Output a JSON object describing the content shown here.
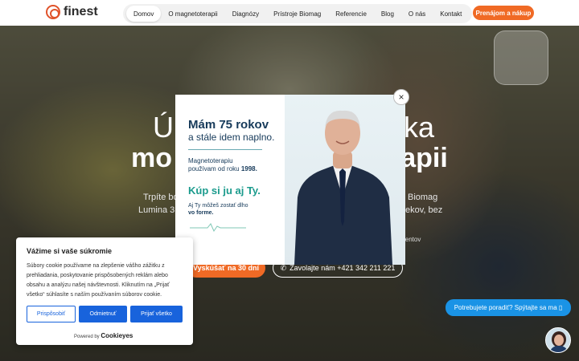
{
  "nav": {
    "logo": "finest",
    "items": [
      "Domov",
      "O magnetoterapii",
      "Diagnózy",
      "Prístroje Biomag",
      "Referencie",
      "Blog",
      "O nás",
      "Kontakt"
    ],
    "cta": "Prenájom a nákup"
  },
  "hero": {
    "title_l1": "Ú",
    "title_l1_right": "ka",
    "title_l2_left": "mo",
    "title_l2_right": "rapii",
    "text_l1_left": "Trpíte bo",
    "text_l1_right": "Biomag",
    "text_l2_left": "Lumina 3D",
    "text_l2_right": "ekov, bez",
    "sub_right": "ientov",
    "btn_primary": "Vyskúšať na 30 dní",
    "btn_secondary": "Zavolajte nám +421 342 211 221"
  },
  "modal": {
    "headline": "Mám 75 rokov",
    "subheadline": "a stále idem naplno.",
    "p1_l1": "Magnetoterapiu",
    "p1_l2": "používam od roku ",
    "p1_year": "1998.",
    "cta": "Kúp si ju aj Ty.",
    "p2_l1": "Aj Ty môžeš zostať dlho",
    "p2_l2": "vo forme.",
    "close": "×"
  },
  "cookie": {
    "title": "Vážime si vaše súkromie",
    "text": "Súbory cookie používame na zlepšenie vášho zážitku z prehliadania, poskytovanie prispôsobených reklám alebo obsahu a analýzu našej návštevnosti. Kliknutím na „Prijať všetko“ súhlasíte s naším používaním súborov cookie.",
    "btn_customize": "Prispôsobiť",
    "btn_reject": "Odmietnuť",
    "btn_accept": "Prijať všetko",
    "powered": "Powered by ",
    "brand": "Cookieyes"
  },
  "chat": {
    "label": "Potrebujete poradiť? Spýtajte sa ma ▯"
  }
}
